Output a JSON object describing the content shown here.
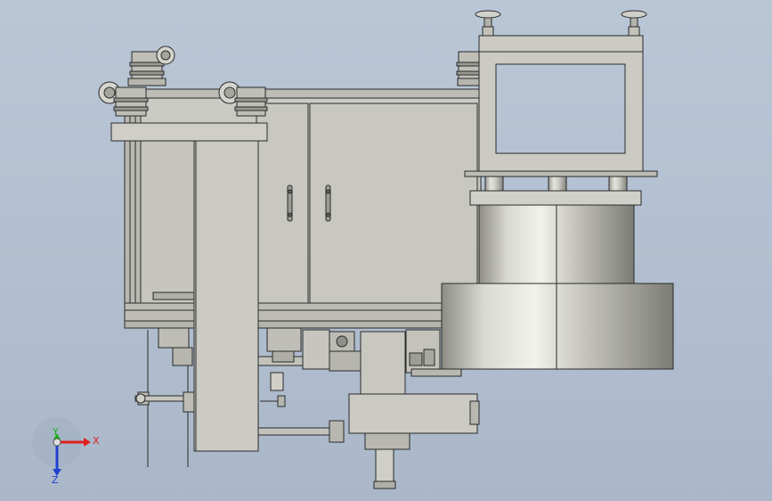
{
  "viewport": {
    "background_color": "#b6c3d4"
  },
  "triad": {
    "x_label": "X",
    "y_label": "Y",
    "z_label": "Z",
    "x_color": "#e02020",
    "y_color": "#18b018",
    "z_color": "#2040d0"
  },
  "model": {
    "metal_color": "#c9c9c3",
    "outline_color": "#2a2a2a"
  }
}
